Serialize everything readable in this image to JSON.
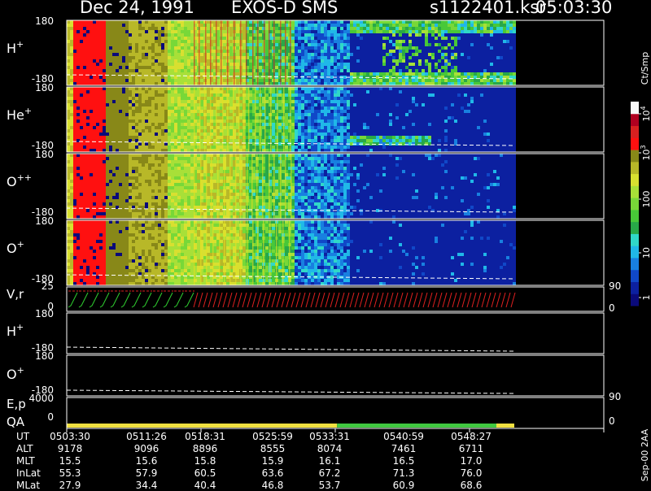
{
  "header": {
    "date": "Dec 24, 1991",
    "mission": "EXOS-D SMS",
    "filename": "s1122401.ksr",
    "time": "05:03:30"
  },
  "colorbar": {
    "unit_label": "Ct/Smp",
    "tick_labels": [
      "1",
      "10",
      "100",
      "10",
      "10"
    ],
    "tick_superscripts": [
      "",
      "",
      "",
      "3",
      "4"
    ],
    "colors": [
      "#0a0a7a",
      "#0c20a0",
      "#1048c8",
      "#1880e0",
      "#20b8e8",
      "#30d8c8",
      "#28a848",
      "#48c838",
      "#78d838",
      "#a8e038",
      "#d8e030",
      "#b8b828",
      "#888818",
      "#ff1010",
      "#d82020",
      "#b00020",
      "#f8f8f8"
    ]
  },
  "panels": [
    {
      "id": "h-plus",
      "label": "H",
      "sup": "+",
      "ymax": "180",
      "ymin": "-180"
    },
    {
      "id": "he-plus",
      "label": "He",
      "sup": "+",
      "ymax": "180",
      "ymin": "-180"
    },
    {
      "id": "o-plusplus",
      "label": "O",
      "sup": "++",
      "ymax": "180",
      "ymin": "-180"
    },
    {
      "id": "o-plus",
      "label": "O",
      "sup": "+",
      "ymax": "180",
      "ymin": "-180"
    }
  ],
  "vr_panel": {
    "label": "V,r",
    "ymax": "25",
    "ymin": "0",
    "right_top": "90",
    "right_bottom": "0"
  },
  "h_line_panel": {
    "label": "H",
    "sup": "+",
    "ymax": "180",
    "ymin": "-180"
  },
  "o_line_panel": {
    "label": "O",
    "sup": "+",
    "ymax": "180",
    "ymin": "-180"
  },
  "ep_panel": {
    "label": "E,p",
    "ymax": "4000",
    "ymin": "0",
    "right_top": "90",
    "right_bottom": "0"
  },
  "qa_panel": {
    "label": "QA",
    "segments": [
      {
        "from": 0,
        "to": 0.604,
        "color": "#f0e040"
      },
      {
        "from": 0.604,
        "to": 0.96,
        "color": "#40c840"
      },
      {
        "from": 0.96,
        "to": 1.0,
        "color": "#f0e040"
      }
    ]
  },
  "timeline": {
    "row_labels": [
      "UT",
      "ALT",
      "MLT",
      "InLat",
      "MLat"
    ],
    "columns": [
      [
        "0503:30",
        "9178",
        "15.5",
        "55.3",
        "27.9"
      ],
      [
        "0511:26",
        "9096",
        "15.6",
        "57.9",
        "34.4"
      ],
      [
        "0518:31",
        "8896",
        "15.8",
        "60.5",
        "40.4"
      ],
      [
        "0525:59",
        "8555",
        "15.9",
        "63.6",
        "46.8"
      ],
      [
        "0533:31",
        "8074",
        "16.1",
        "67.2",
        "53.7"
      ],
      [
        "0540:59",
        "7461",
        "16.5",
        "71.3",
        "60.9"
      ],
      [
        "0548:27",
        "6711",
        "17.0",
        "76.0",
        "68.6"
      ]
    ]
  },
  "footer": {
    "note": "Sep-00 2AA"
  }
}
